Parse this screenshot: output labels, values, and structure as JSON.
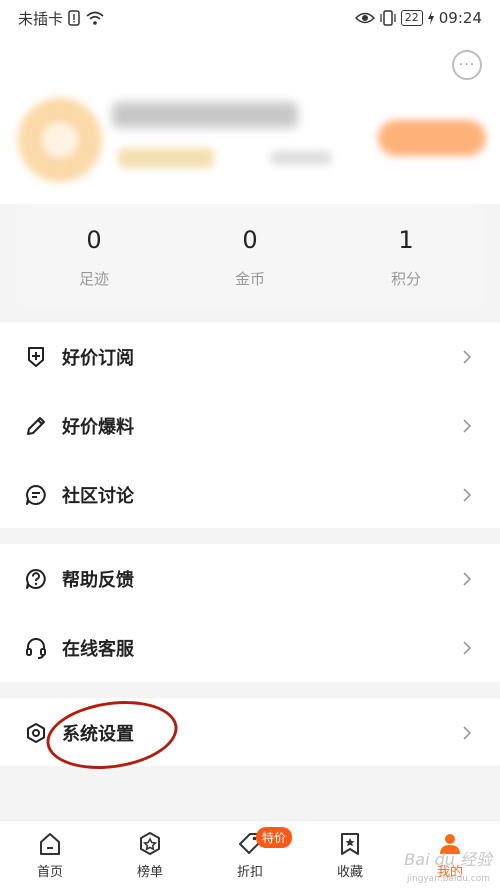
{
  "status_bar": {
    "carrier": "未插卡",
    "battery": "22",
    "time": "09:24"
  },
  "header": {
    "message_button": "···"
  },
  "stats": [
    {
      "value": "0",
      "label": "足迹"
    },
    {
      "value": "0",
      "label": "金币"
    },
    {
      "value": "1",
      "label": "积分"
    }
  ],
  "menu": {
    "group1": [
      {
        "label": "好价订阅",
        "icon": "shield-plus-icon"
      },
      {
        "label": "好价爆料",
        "icon": "pencil-icon"
      },
      {
        "label": "社区讨论",
        "icon": "chat-icon"
      }
    ],
    "group2": [
      {
        "label": "帮助反馈",
        "icon": "help-icon"
      },
      {
        "label": "在线客服",
        "icon": "headset-icon"
      }
    ],
    "group3": [
      {
        "label": "系统设置",
        "icon": "settings-icon"
      }
    ]
  },
  "tabbar": {
    "items": [
      {
        "label": "首页",
        "icon": "home-icon"
      },
      {
        "label": "榜单",
        "icon": "ranking-icon"
      },
      {
        "label": "折扣",
        "icon": "tag-icon",
        "badge": "特价"
      },
      {
        "label": "收藏",
        "icon": "bookmark-icon"
      },
      {
        "label": "我的",
        "icon": "user-icon",
        "active": true
      }
    ]
  },
  "watermark": {
    "text": "Bai du 经验",
    "sub": "jingyan.baidu.com"
  },
  "colors": {
    "accent": "#ff6a1a",
    "annotation": "#b01e10"
  }
}
